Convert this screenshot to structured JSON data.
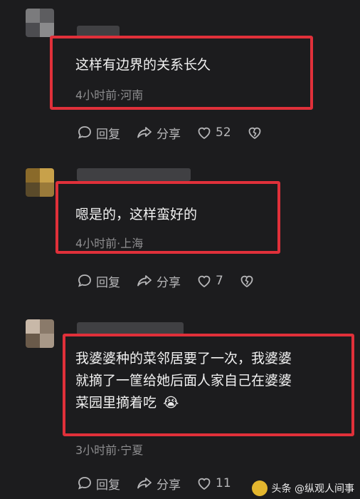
{
  "comments": [
    {
      "text": "这样有边界的关系长久",
      "meta": "4小时前·河南",
      "reply": "回复",
      "share": "分享",
      "likes": "52"
    },
    {
      "text": "嗯是的，这样蛮好的",
      "meta": "4小时前·上海",
      "reply": "回复",
      "share": "分享",
      "likes": "7"
    },
    {
      "text_lines": [
        "我婆婆种的菜邻居要了一次，我婆婆",
        "就摘了一筐给她后面人家自己在婆婆",
        "菜园里摘着吃"
      ],
      "emoji": "😭",
      "meta": "3小时前·宁夏",
      "reply": "回复",
      "share": "分享",
      "likes": "11"
    }
  ],
  "watermark": {
    "text": "头条 @纵观人间事"
  },
  "colors": {
    "highlight_border": "#e0303a",
    "background": "#1c1c1e"
  }
}
